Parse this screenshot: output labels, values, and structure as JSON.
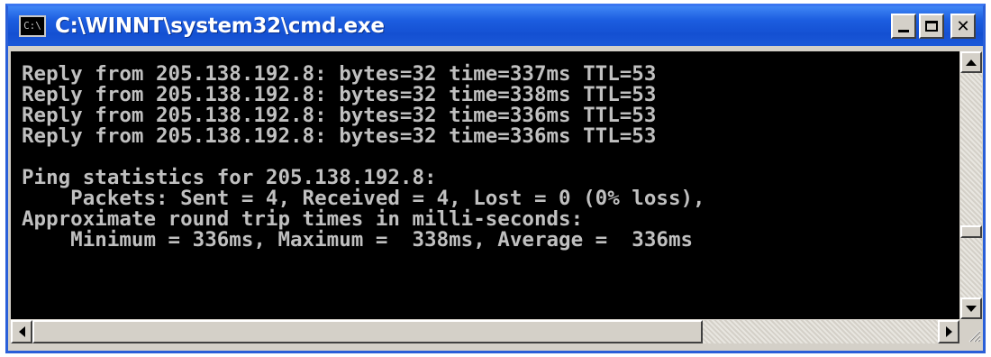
{
  "window": {
    "title": "C:\\WINNT\\system32\\cmd.exe",
    "icon_label": "C:\\",
    "icons": {
      "app": "cmd-icon",
      "minimize": "minimize-icon",
      "maximize": "maximize-icon",
      "close": "close-icon"
    },
    "close_glyph": "✕"
  },
  "console": {
    "lines": [
      "Reply from 205.138.192.8: bytes=32 time=337ms TTL=53",
      "Reply from 205.138.192.8: bytes=32 time=338ms TTL=53",
      "Reply from 205.138.192.8: bytes=32 time=336ms TTL=53",
      "Reply from 205.138.192.8: bytes=32 time=336ms TTL=53",
      "",
      "Ping statistics for 205.138.192.8:",
      "    Packets: Sent = 4, Received = 4, Lost = 0 (0% loss),",
      "Approximate round trip times in milli-seconds:",
      "    Minimum = 336ms, Maximum =  338ms, Average =  336ms"
    ]
  },
  "scroll": {
    "vertical_position": 0.72,
    "horizontal_position": 0.0
  },
  "colors": {
    "titlebar": "#1c5de0",
    "console_bg": "#000000",
    "console_fg": "#c0c0c0"
  }
}
